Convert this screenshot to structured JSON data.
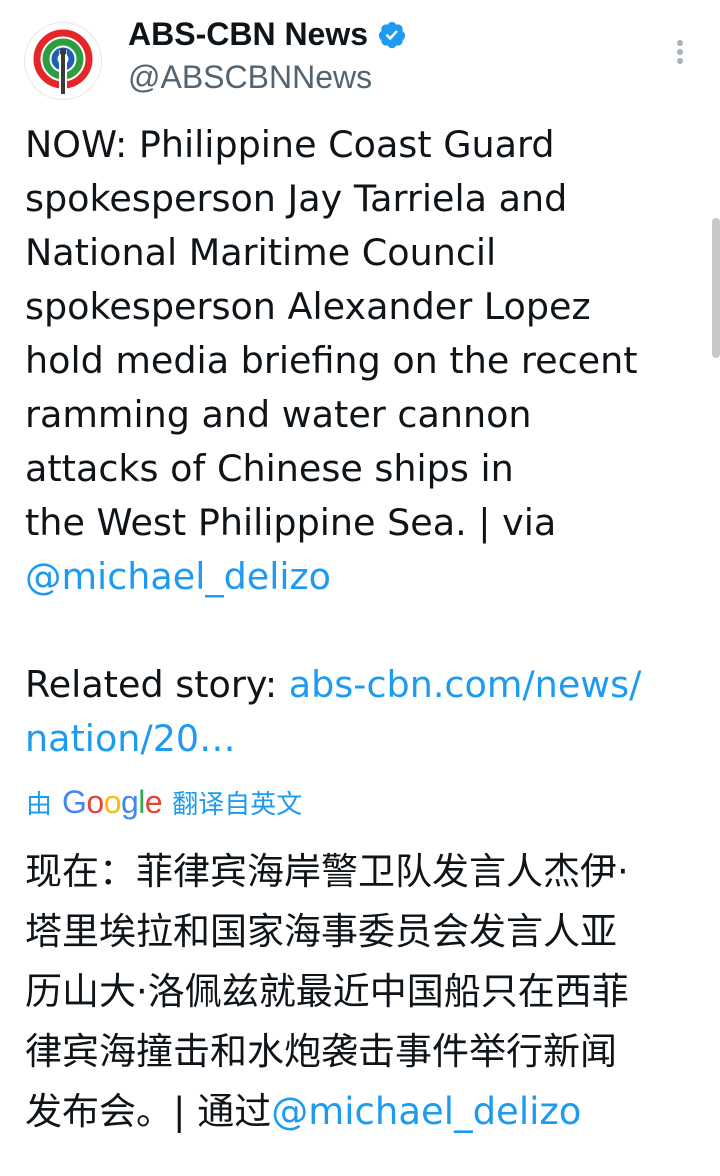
{
  "account": {
    "name": "ABS-CBN News",
    "handle": "@ABSCBNNews",
    "verified": true,
    "avatar_icon": "abs-cbn-logo-icon"
  },
  "tweet": {
    "lines": [
      "NOW: Philippine Coast Guard",
      "spokesperson Jay Tarriela and",
      "National Maritime Council",
      "spokesperson Alexander Lopez",
      "hold media briefing on the recent",
      "ramming and water cannon",
      "attacks of Chinese ships in",
      "the West Philippine Sea. | via"
    ],
    "mention": "@michael_delizo",
    "related_label": "Related story: ",
    "related_link_part1": "abs-cbn.com/news/",
    "related_link_part2": "nation/20…"
  },
  "translation": {
    "prefix": "由",
    "google_letters": [
      "G",
      "o",
      "o",
      "g",
      "l",
      "e"
    ],
    "suffix": "翻译自英文",
    "lines": [
      "现在：菲律宾海岸警卫队发言人杰伊·",
      "塔里埃拉和国家海事委员会发言人亚",
      "历山大·洛佩兹就最近中国船只在西菲",
      "律宾海撞击和水炮袭击事件举行新闻"
    ],
    "last_line_text": "发布会。| 通过",
    "last_line_mention": "@michael_delizo"
  },
  "colors": {
    "link": "#1d9bf0",
    "text": "#0f1419",
    "secondary": "#536471",
    "verified": "#1d9bf0"
  }
}
